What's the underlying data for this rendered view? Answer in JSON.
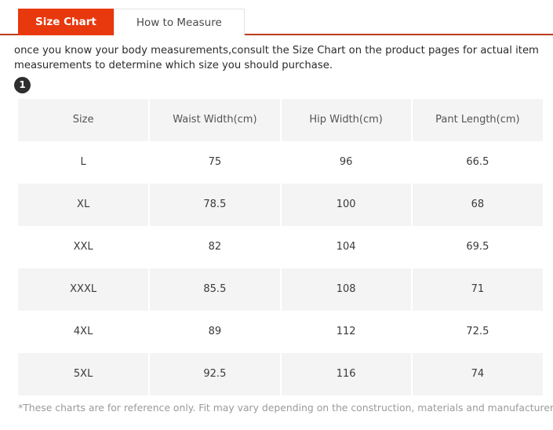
{
  "tabs": [
    {
      "label": "Size Chart",
      "active": true
    },
    {
      "label": "How to Measure",
      "active": false
    }
  ],
  "description": "once you know your body measurements,consult the Size Chart on the product pages for actual item measurements to determine which size you should purchase.",
  "step_badge": "1",
  "footnote": "*These charts are for reference only. Fit may vary depending on the construction, materials and manufacturer.",
  "colors": {
    "accent": "#e8380d",
    "accent_border": "#b93d1c",
    "header_bg": "#f4f4f4",
    "zebra_bg": "#f4f4f4",
    "badge_bg": "#2e2e2e",
    "footnote_text": "#9a9a9a"
  },
  "chart_data": {
    "type": "table",
    "title": "Size Chart",
    "columns": [
      "Size",
      "Waist Width(cm)",
      "Hip Width(cm)",
      "Pant Length(cm)"
    ],
    "rows": [
      [
        "L",
        "75",
        "96",
        "66.5"
      ],
      [
        "XL",
        "78.5",
        "100",
        "68"
      ],
      [
        "XXL",
        "82",
        "104",
        "69.5"
      ],
      [
        "XXXL",
        "85.5",
        "108",
        "71"
      ],
      [
        "4XL",
        "89",
        "112",
        "72.5"
      ],
      [
        "5XL",
        "92.5",
        "116",
        "74"
      ]
    ]
  }
}
